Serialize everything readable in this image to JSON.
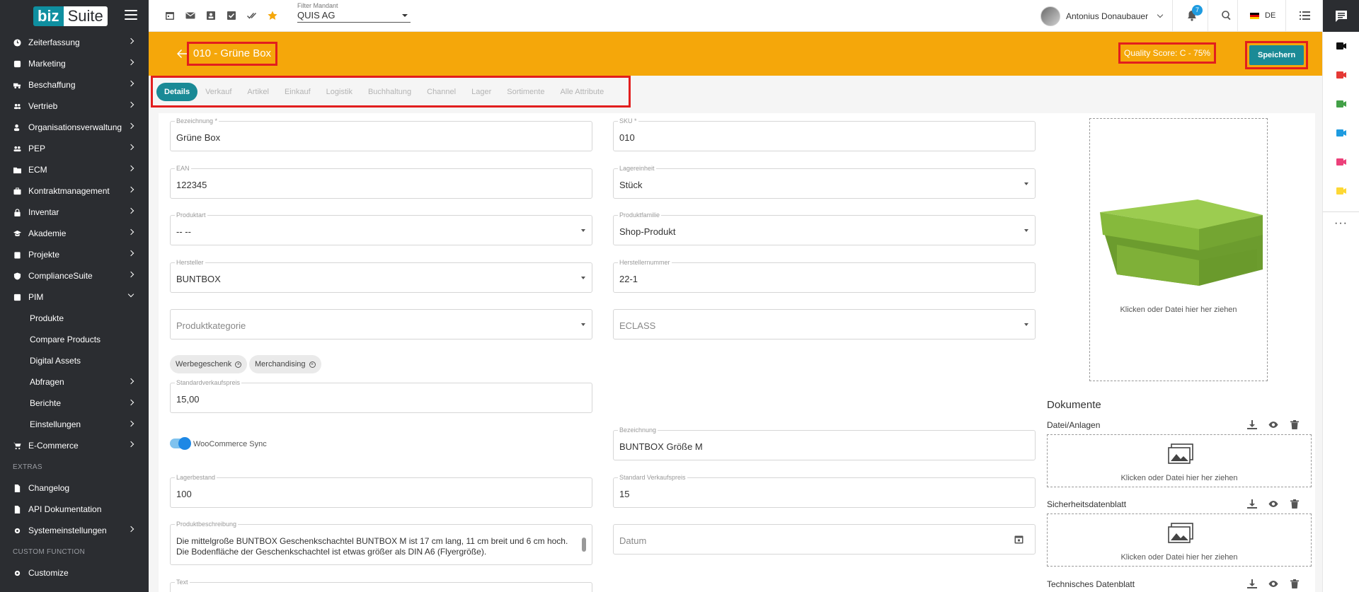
{
  "logo": {
    "part1": "biz",
    "part2": "Suite"
  },
  "sidebar": {
    "items": [
      {
        "label": "Zeiterfassung",
        "icon": "clock-icon"
      },
      {
        "label": "Marketing",
        "icon": "megaphone-icon"
      },
      {
        "label": "Beschaffung",
        "icon": "truck-icon"
      },
      {
        "label": "Vertrieb",
        "icon": "people-icon"
      },
      {
        "label": "Organisationsverwaltung",
        "icon": "org-icon"
      },
      {
        "label": "PEP",
        "icon": "group-icon"
      },
      {
        "label": "ECM",
        "icon": "folder-icon"
      },
      {
        "label": "Kontraktmanagement",
        "icon": "briefcase-icon"
      },
      {
        "label": "Inventar",
        "icon": "lock-icon"
      },
      {
        "label": "Akademie",
        "icon": "graduation-icon"
      },
      {
        "label": "Projekte",
        "icon": "clipboard-icon"
      },
      {
        "label": "ComplianceSuite",
        "icon": "shield-icon"
      },
      {
        "label": "PIM",
        "icon": "tag-icon"
      }
    ],
    "pim_sub": [
      {
        "label": "Produkte",
        "has_children": false
      },
      {
        "label": "Compare Products",
        "has_children": false
      },
      {
        "label": "Digital Assets",
        "has_children": false
      },
      {
        "label": "Abfragen",
        "has_children": true
      },
      {
        "label": "Berichte",
        "has_children": true
      },
      {
        "label": "Einstellungen",
        "has_children": true
      }
    ],
    "ecommerce": "E-Commerce",
    "extras_title": "EXTRAS",
    "extras": [
      {
        "label": "Changelog",
        "icon": "document-icon"
      },
      {
        "label": "API Dokumentation",
        "icon": "document-icon"
      },
      {
        "label": "Systemeinstellungen",
        "icon": "gear-icon"
      }
    ],
    "custom_title": "CUSTOM FUNCTION",
    "custom": [
      {
        "label": "Customize",
        "icon": "gear-icon"
      }
    ]
  },
  "topbar": {
    "filter_label": "Filter Mandant",
    "filter_value": "QUIS AG",
    "user_name": "Antonius Donaubauer",
    "notifications": "7",
    "language": "DE"
  },
  "header": {
    "title": "010 - Grüne Box",
    "quality_score": "Quality Score: C  -  75%",
    "save_label": "Speichern"
  },
  "tabs": [
    "Details",
    "Verkauf",
    "Artikel",
    "Einkauf",
    "Logistik",
    "Buchhaltung",
    "Channel",
    "Lager",
    "Sortimente",
    "Alle Attribute"
  ],
  "form": {
    "bezeichnung": {
      "label": "Bezeichnung *",
      "value": "Grüne Box"
    },
    "sku": {
      "label": "SKU *",
      "value": "010"
    },
    "ean": {
      "label": "EAN",
      "value": "122345"
    },
    "lagereinheit": {
      "label": "Lagereinheit",
      "value": "Stück"
    },
    "produktart": {
      "label": "Produktart",
      "value": "-- --"
    },
    "produktfamilie": {
      "label": "Produktfamilie",
      "value": "Shop-Produkt"
    },
    "hersteller": {
      "label": "Hersteller",
      "value": "BUNTBOX"
    },
    "herstellernummer": {
      "label": "Herstellernummer",
      "value": "22-1"
    },
    "produktkategorie": {
      "placeholder": "Produktkategorie"
    },
    "eclass": {
      "placeholder": "ECLASS"
    },
    "chips": [
      "Werbegeschenk",
      "Merchandising"
    ],
    "standardverkaufspreis": {
      "label": "Standardverkaufspreis",
      "value": "15,00"
    },
    "woocommerce_sync": "WooCommerce Sync",
    "bezeichnung2": {
      "label": "Bezeichnung",
      "value": "BUNTBOX Größe M"
    },
    "lagerbestand": {
      "label": "Lagerbestand",
      "value": "100"
    },
    "standard_verkaufspreis": {
      "label": "Standard Verkaufspreis",
      "value": "15"
    },
    "produktbeschreibung": {
      "label": "Produktbeschreibung",
      "value": "Die mittelgroße BUNTBOX Geschenkschachtel BUNTBOX M ist 17 cm lang, 11 cm breit und 6 cm hoch. Die Bodenfläche der Geschenkschachtel ist etwas größer als DIN A6 (Flyergröße)."
    },
    "datum": {
      "placeholder": "Datum"
    },
    "text": {
      "label": "Text"
    }
  },
  "image_drop_text": "Klicken oder Datei hier her ziehen",
  "documents": {
    "title": "Dokumente",
    "sections": [
      {
        "label": "Datei/Anlagen",
        "drop": "Klicken oder Datei hier her ziehen"
      },
      {
        "label": "Sicherheitsdatenblatt",
        "drop": "Klicken oder Datei hier her ziehen"
      },
      {
        "label": "Technisches Datenblatt"
      }
    ]
  },
  "colors": {
    "accent": "#1a8a96",
    "header": "#f5a70a",
    "highlight": "#e21e1e",
    "sidebar": "#2b2d31"
  }
}
